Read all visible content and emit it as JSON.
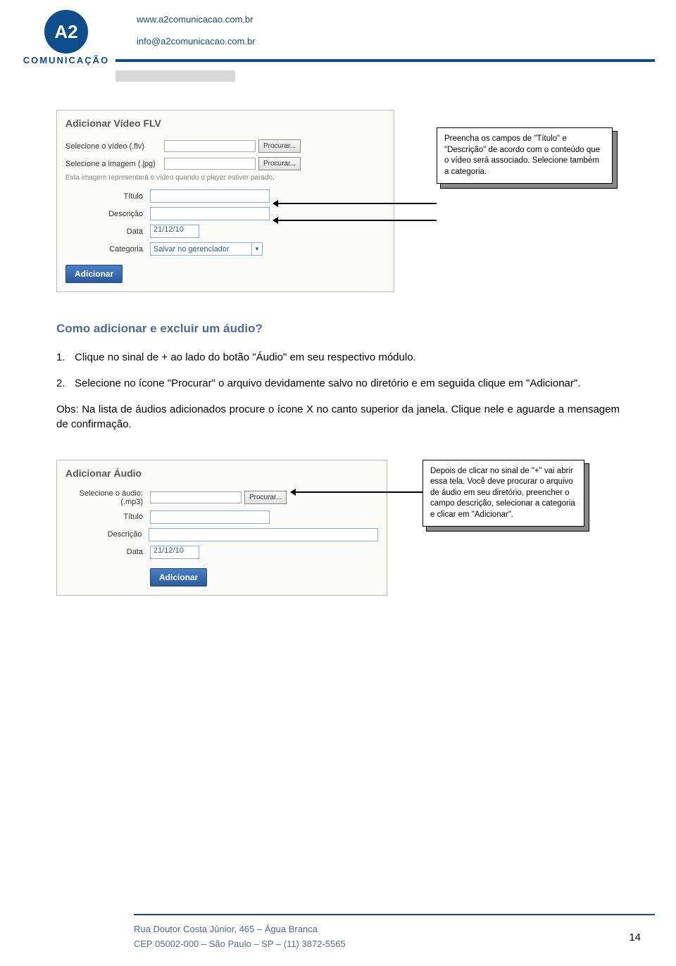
{
  "header": {
    "logo_text": "A2",
    "logo_subtitle": "COMUNICAÇÃO",
    "url": "www.a2comunicacao.com.br",
    "email": "info@a2comunicacao.com.br"
  },
  "form_video": {
    "title": "Adicionar Vídeo FLV",
    "row1_label": "Selecione o vídeo (.flv)",
    "row2_label": "Selecione a imagem (.jpg)",
    "procurar": "Procurar...",
    "hint": "Esta imagem representará o vídeo quando o player estiver parado.",
    "titulo_label": "Título",
    "descricao_label": "Descrição",
    "data_label": "Data",
    "data_value": "21/12/10",
    "categoria_label": "Categoria",
    "categoria_value": "Salvar no gerenciador",
    "adicionar": "Adicionar"
  },
  "callout1": "Preencha os campos de \"Título\" e \"Descrição\" de acordo com o conteúdo que o vídeo será associado. Selecione também a categoria.",
  "section": {
    "heading": "Como adicionar e excluir um áudio?",
    "item1_num": "1.",
    "item1": "Clique no sinal de + ao lado do botão \"Áudio\" em seu respectivo módulo.",
    "item2_num": "2.",
    "item2": "Selecione no ícone \"Procurar\" o arquivo devidamente salvo no diretório e em seguida clique em \"Adicionar\".",
    "obs": "Obs: Na lista de áudios adicionados procure o ícone X no canto superior da janela. Clique nele e aguarde a mensagem de confirmação."
  },
  "form_audio": {
    "title": "Adicionar Áudio",
    "row1_label1": "Selecione o áudio:",
    "row1_label2": "(.mp3)",
    "procurar": "Procurar...",
    "titulo_label": "Título",
    "descricao_label": "Descrição",
    "data_label": "Data",
    "data_value": "21/12/10",
    "adicionar": "Adicionar"
  },
  "callout2": "Depois de clicar no sinal de \"+\" vai abrir essa tela. Você deve procurar o arquivo de áudio em seu diretório, preencher o campo descrição, selecionar a categoria e clicar em \"Adicionar\".",
  "footer": {
    "line1": "Rua Doutor Costa Júnior, 465 – Água Branca",
    "line2": "CEP 05002-000 – São Paulo – SP – (11) 3872-5565"
  },
  "pagenum": "14"
}
